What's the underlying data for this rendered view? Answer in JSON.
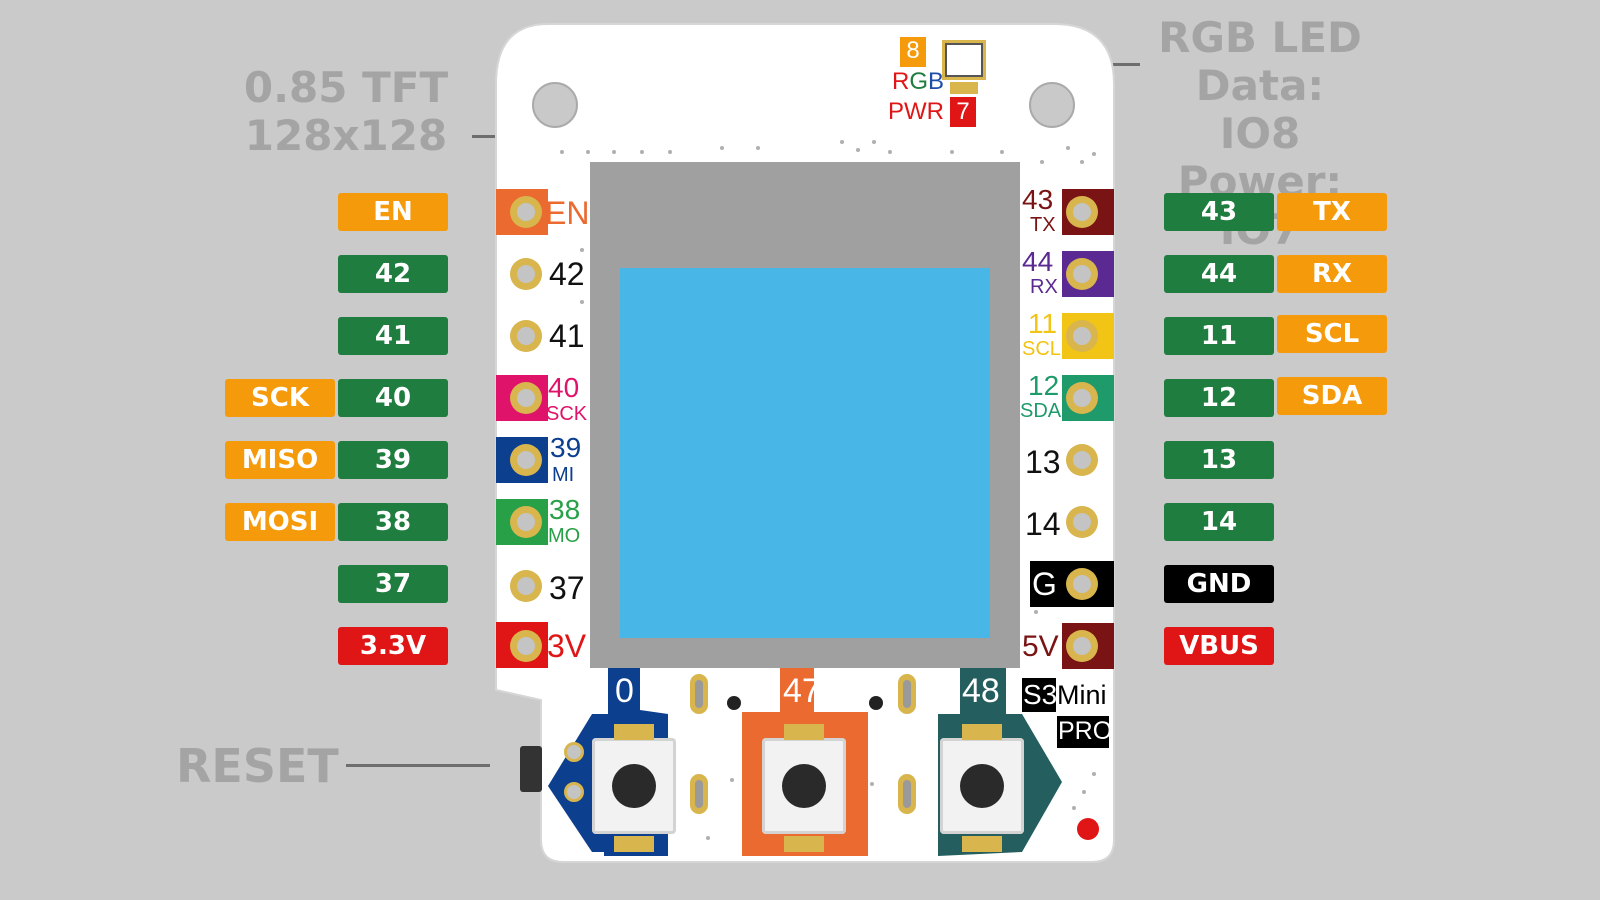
{
  "callouts": {
    "tft_line1": "0.85 TFT",
    "tft_line2": "128x128",
    "led_line1": "RGB LED",
    "led_line2": "Data: IO8",
    "led_line3": "Power: IO7",
    "reset": "RESET"
  },
  "board": {
    "rgb_num": "8",
    "rgb_text": "RGB",
    "pwr_text": "PWR",
    "pwr_num": "7",
    "brand_s3": "S3",
    "brand_mini": "Mini",
    "brand_pro": "PRO",
    "btn0": "0",
    "btn47": "47",
    "btn48": "48",
    "left_pins": {
      "en": "EN",
      "p42": "42",
      "p41": "41",
      "p40": "40",
      "p40sub": "SCK",
      "p39": "39",
      "p39sub": "MI",
      "p38": "38",
      "p38sub": "MO",
      "p37": "37",
      "p3v": "3V"
    },
    "right_pins": {
      "p43": "43",
      "p43sub": "TX",
      "p44": "44",
      "p44sub": "RX",
      "p11": "11",
      "p11sub": "SCL",
      "p12": "12",
      "p12sub": "SDA",
      "p13": "13",
      "p14": "14",
      "g": "G",
      "p5v": "5V"
    }
  },
  "left_labels": {
    "en": "EN",
    "p42": "42",
    "p41": "41",
    "sck": "SCK",
    "p40": "40",
    "miso": "MISO",
    "p39": "39",
    "mosi": "MOSI",
    "p38": "38",
    "p37": "37",
    "v33": "3.3V"
  },
  "right_labels": {
    "p43": "43",
    "tx": "TX",
    "p44": "44",
    "rx": "RX",
    "p11": "11",
    "scl": "SCL",
    "p12": "12",
    "sda": "SDA",
    "p13": "13",
    "p14": "14",
    "gnd": "GND",
    "vbus": "VBUS"
  },
  "colors": {
    "background": "#cacaca",
    "label_green": "#1e7d3f",
    "label_orange": "#f59a0b",
    "label_red": "#e01616",
    "screen_blue": "#48b6e6",
    "screen_frame": "#a0a0a0",
    "button_blue": "#0d3f8f",
    "button_orange": "#ea6a2f",
    "button_teal": "#245e5e"
  }
}
